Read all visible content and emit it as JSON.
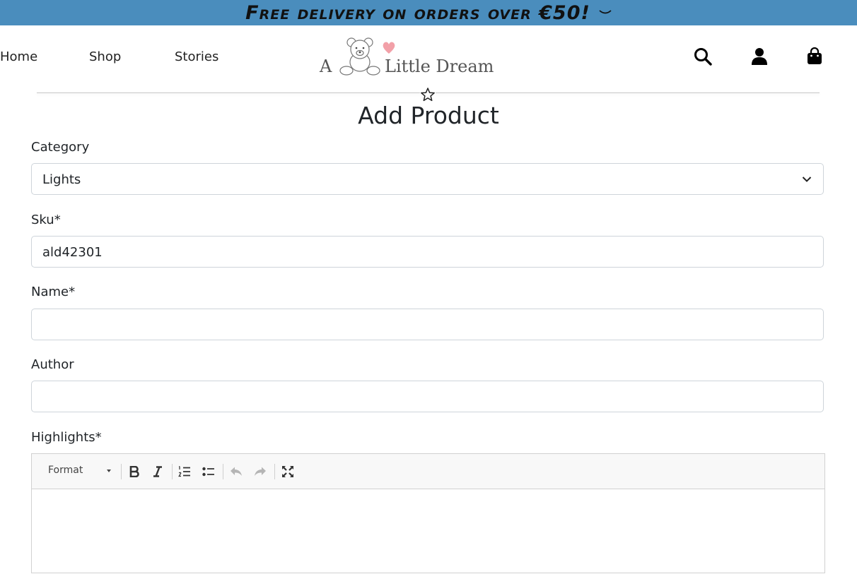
{
  "promo": {
    "text": "Free delivery on orders over €50!",
    "chevron_icon": "chevron-down-icon"
  },
  "nav": {
    "home": "Home",
    "shop": "Shop",
    "stories": "Stories"
  },
  "logo": {
    "letter": "A",
    "name": "Little Dream"
  },
  "header_icons": [
    "search-icon",
    "user-icon",
    "shopping-bag-icon"
  ],
  "divider_icon": "star-outline-icon",
  "page": {
    "title": "Add Product"
  },
  "form": {
    "category": {
      "label": "Category",
      "value": "Lights"
    },
    "sku": {
      "label": "Sku*",
      "value": "ald42301"
    },
    "name": {
      "label": "Name*",
      "value": ""
    },
    "author": {
      "label": "Author",
      "value": ""
    },
    "highlights": {
      "label": "Highlights*"
    }
  },
  "editor": {
    "format_label": "Format",
    "tools": [
      "bold-icon",
      "italic-icon",
      "numbered-list-icon",
      "bulleted-list-icon",
      "undo-icon",
      "redo-icon",
      "maximize-icon"
    ]
  },
  "colors": {
    "promo_bg": "#4a8dbd",
    "border": "#ced4da",
    "text": "#212529"
  }
}
